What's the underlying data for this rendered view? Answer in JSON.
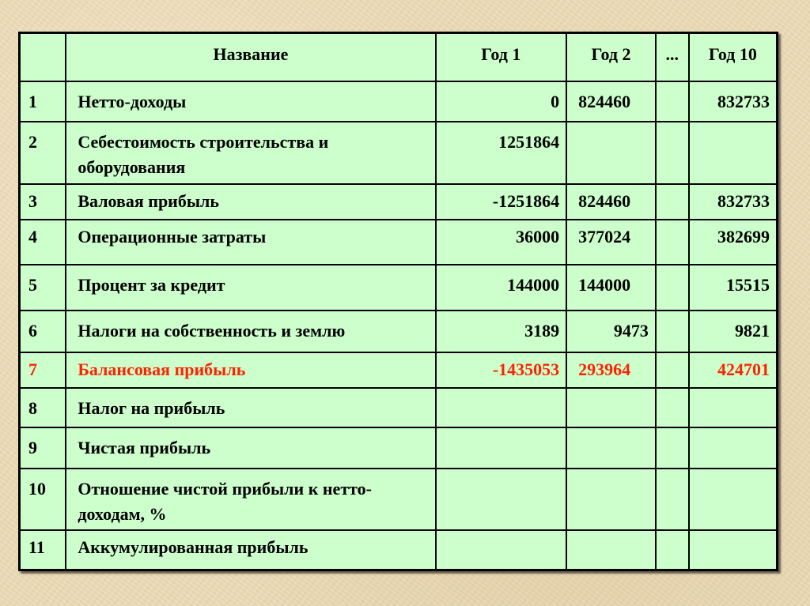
{
  "table": {
    "headers": {
      "num": "",
      "name": "Название",
      "year1": "Год 1",
      "year2": "Год 2",
      "ellipsis": "...",
      "year10": "Год 10"
    },
    "rows": [
      {
        "num": "1",
        "name": "Нетто-доходы",
        "year1": "0",
        "year2": "824460",
        "ellipsis": "",
        "year10": "832733"
      },
      {
        "num": "2",
        "name": "Себестоимость строительства и оборудования",
        "year1": "1251864",
        "year2": "",
        "ellipsis": "",
        "year10": ""
      },
      {
        "num": "3",
        "name": "Валовая прибыль",
        "year1": "-1251864",
        "year2": "824460",
        "ellipsis": "",
        "year10": "832733"
      },
      {
        "num": "4",
        "name": "Операционные затраты",
        "year1": "36000",
        "year2": "377024",
        "ellipsis": "",
        "year10": "382699"
      },
      {
        "num": "5",
        "name": "Процент за кредит",
        "year1": "144000",
        "year2": "144000",
        "ellipsis": "",
        "year10": "15515"
      },
      {
        "num": "6",
        "name": "Налоги на собственность и землю",
        "year1": "3189",
        "year2": "9473",
        "ellipsis": "",
        "year10": "9821"
      },
      {
        "num": "7",
        "name": "Балансовая прибыль",
        "year1": "-1435053",
        "year2": "293964",
        "ellipsis": "",
        "year10": "424701",
        "highlight": "#ff2200"
      },
      {
        "num": "8",
        "name": "Налог на прибыль",
        "year1": "",
        "year2": "",
        "ellipsis": "",
        "year10": ""
      },
      {
        "num": "9",
        "name": "Чистая прибыль",
        "year1": "",
        "year2": "",
        "ellipsis": "",
        "year10": ""
      },
      {
        "num": "10",
        "name": "Отношение чистой прибыли к нетто-доходам, %",
        "year1": "",
        "year2": "",
        "ellipsis": "",
        "year10": ""
      },
      {
        "num": "11",
        "name": "Аккумулированная прибыль",
        "year1": "",
        "year2": "",
        "ellipsis": "",
        "year10": ""
      }
    ]
  },
  "colors": {
    "table_background": "#ccffcc",
    "highlight_text": "#ff2200",
    "page_background": "#ead9b4"
  }
}
